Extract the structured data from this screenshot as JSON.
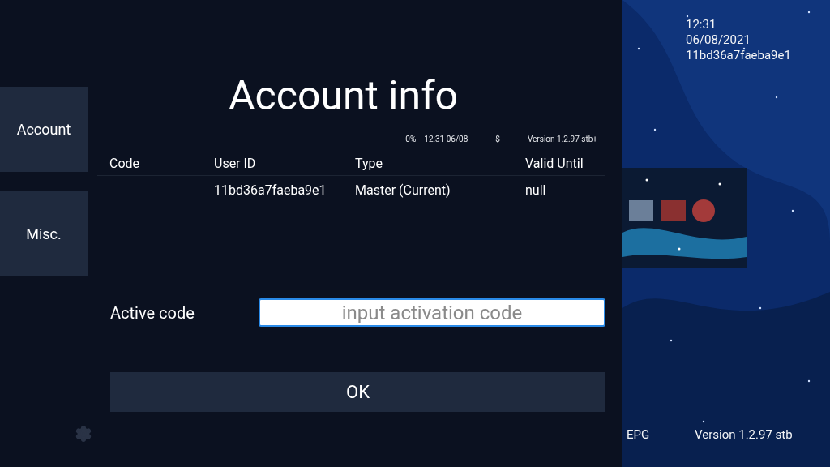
{
  "sidebar": {
    "items": [
      {
        "label": "Account"
      },
      {
        "label": "Misc."
      }
    ]
  },
  "title": "Account info",
  "status": {
    "percent": "0%",
    "datetime": "12:31 06/08",
    "currency": "$",
    "version": "Version 1.2.97 stb+"
  },
  "table": {
    "columns": [
      "Code",
      "User ID",
      "Type",
      "Valid Until"
    ],
    "rows": [
      [
        "",
        "11bd36a7faeba9e1",
        "Master (Current)",
        "null"
      ]
    ]
  },
  "activation": {
    "label": "Active code",
    "placeholder": "input activation code"
  },
  "ok_button": "OK",
  "info": {
    "time": "12:31",
    "date": "06/08/2021",
    "device_id": "11bd36a7faeba9e1"
  },
  "footer": {
    "epg": "EPG",
    "version": "Version 1.2.97 stb"
  }
}
